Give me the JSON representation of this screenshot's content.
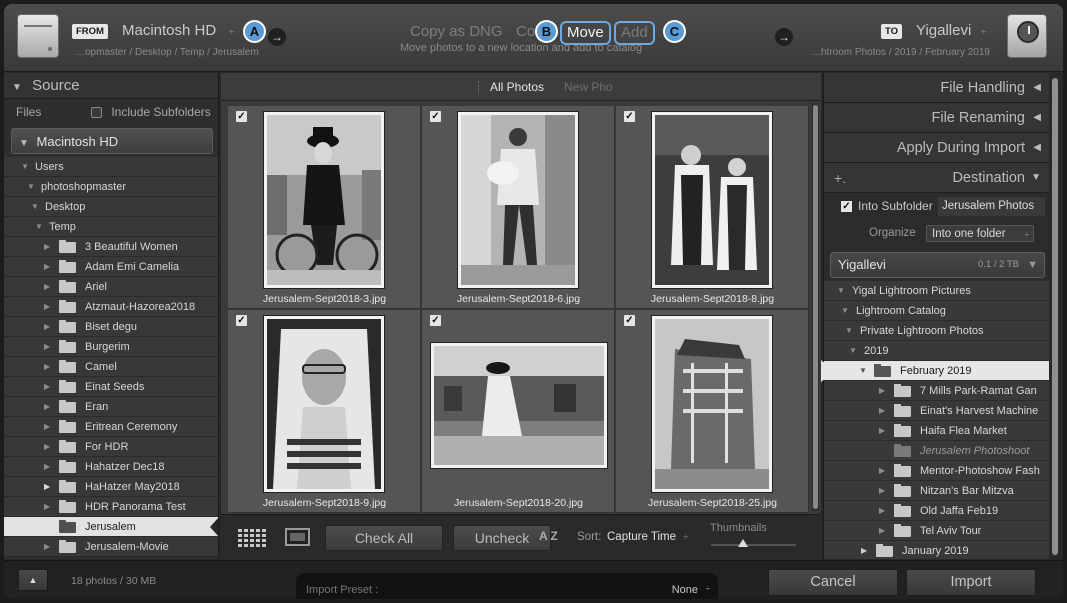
{
  "header": {
    "from_tag": "FROM",
    "source_title": "Macintosh HD",
    "source_path": "…opmaster / Desktop / Temp / Jerusalem",
    "modes": {
      "copy_dng": "Copy as DNG",
      "copy": "Co",
      "move": "Move",
      "add": "Add"
    },
    "mode_description": "Move photos to a new location and add to catalog",
    "markers": {
      "a": "A",
      "b": "B",
      "c": "C"
    },
    "to_tag": "TO",
    "dest_title": "Yigallevi",
    "dest_path": "…htroom Photos / 2019 / February 2019",
    "stepper": "÷"
  },
  "source": {
    "title": "Source",
    "files_label": "Files",
    "include_subfolders": "Include Subfolders",
    "volume": "Macintosh HD",
    "tree": [
      {
        "label": "Users"
      },
      {
        "label": "photoshopmaster"
      },
      {
        "label": "Desktop"
      },
      {
        "label": "Temp"
      }
    ],
    "folders": [
      {
        "label": "3 Beautiful Women"
      },
      {
        "label": "Adam Emi Camelia"
      },
      {
        "label": "Ariel"
      },
      {
        "label": "Atzmaut-Hazorea2018"
      },
      {
        "label": "Biset degu"
      },
      {
        "label": "Burgerim"
      },
      {
        "label": "Camel"
      },
      {
        "label": "Einat Seeds"
      },
      {
        "label": "Eran"
      },
      {
        "label": "Eritrean Ceremony"
      },
      {
        "label": "For HDR"
      },
      {
        "label": "Hahatzer Dec18"
      },
      {
        "label": "HaHatzer May2018"
      },
      {
        "label": "HDR Panorama Test"
      },
      {
        "label": "Jerusalem"
      },
      {
        "label": "Jerusalem-Movie"
      }
    ]
  },
  "center": {
    "tab_all": "All Photos",
    "tab_new": "New Pho",
    "photos": [
      {
        "filename": "Jerusalem-Sept2018-3.jpg",
        "checked": true
      },
      {
        "filename": "Jerusalem-Sept2018-6.jpg",
        "checked": true
      },
      {
        "filename": "Jerusalem-Sept2018-8.jpg",
        "checked": true
      },
      {
        "filename": "Jerusalem-Sept2018-9.jpg",
        "checked": true
      },
      {
        "filename": "Jerusalem-Sept2018-20.jpg",
        "checked": true
      },
      {
        "filename": "Jerusalem-Sept2018-25.jpg",
        "checked": true
      }
    ],
    "toolbar": {
      "check_all": "Check All",
      "uncheck": "Uncheck",
      "sort_icon": "A Z",
      "sort_label": "Sort:",
      "sort_value": "Capture Time",
      "thumbnails": "Thumbnails"
    }
  },
  "right": {
    "file_handling": "File Handling",
    "file_renaming": "File Renaming",
    "apply_during_import": "Apply During Import",
    "destination": "Destination",
    "into_subfolder": "Into Subfolder",
    "subfolder_name": "Jerusalem Photos",
    "organize_label": "Organize",
    "organize_value": "Into one folder",
    "volume": "Yigallevi",
    "capacity": "0.1 / 2 TB",
    "tree": [
      {
        "label": "Yigal Lightroom Pictures"
      },
      {
        "label": "Lightroom Catalog"
      },
      {
        "label": "Private Lightroom Photos"
      },
      {
        "label": "2019"
      },
      {
        "label": "February 2019"
      },
      {
        "label": "7 Mills Park-Ramat Gan"
      },
      {
        "label": "Einat's Harvest Machine"
      },
      {
        "label": "Haifa Flea Market"
      },
      {
        "label": "Jerusalem Photoshoot"
      },
      {
        "label": "Mentor-Photoshow Fash"
      },
      {
        "label": "Nitzan's Bar Mitzva"
      },
      {
        "label": "Old Jaffa Feb19"
      },
      {
        "label": "Tel Aviv Tour"
      },
      {
        "label": "January 2019"
      }
    ]
  },
  "bottom": {
    "summary": "18 photos / 30 MB",
    "preset_label": "Import Preset :",
    "preset_value": "None",
    "cancel": "Cancel",
    "import": "Import"
  },
  "icons": {
    "arrow": "→",
    "check": "✓",
    "collapse": "▼",
    "expand": "▶",
    "panel_left": "◀",
    "up": "▲",
    "plus": "+."
  },
  "colors": {
    "accent": "#6fa8dc",
    "marker_fill": "#5b9bd5"
  }
}
